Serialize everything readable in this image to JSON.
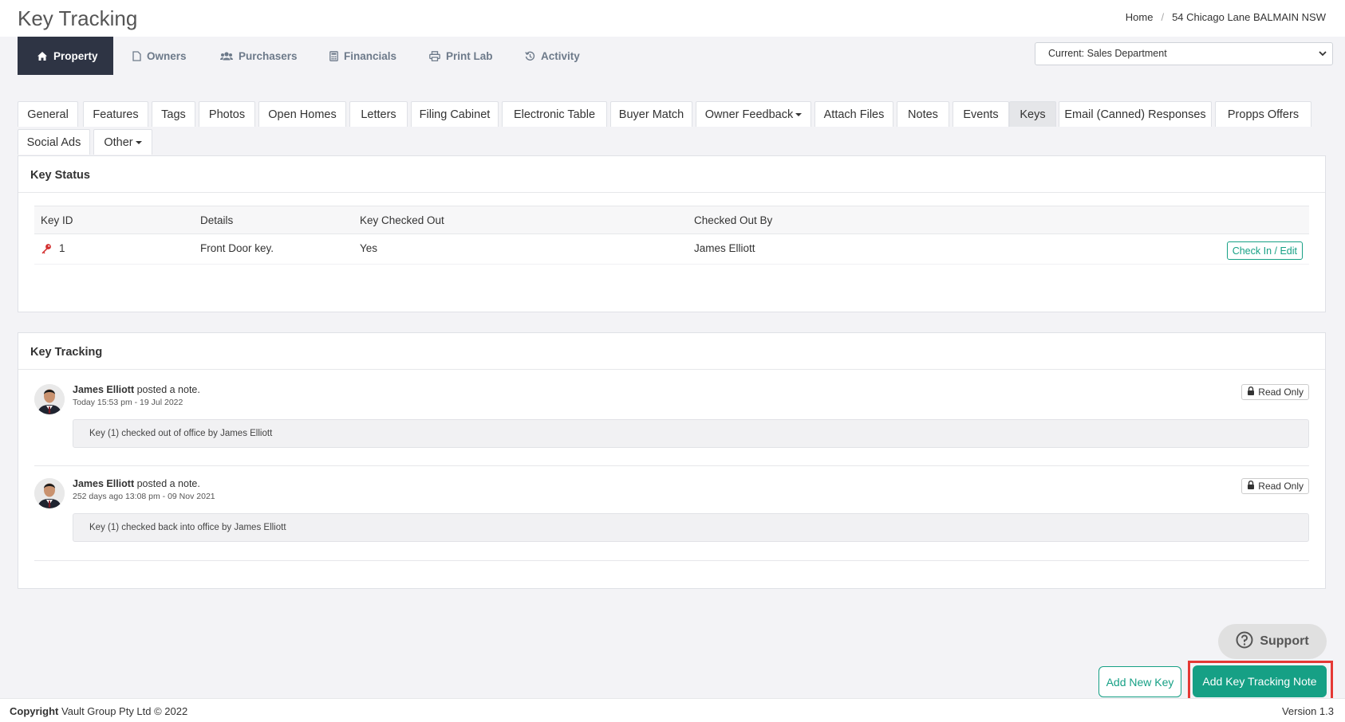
{
  "header": {
    "title": "Key Tracking",
    "breadcrumb": [
      "Home",
      "54 Chicago Lane BALMAIN NSW"
    ]
  },
  "nav": {
    "items": [
      {
        "label": "Property",
        "icon": "home-icon",
        "active": true
      },
      {
        "label": "Owners",
        "icon": "document-icon"
      },
      {
        "label": "Purchasers",
        "icon": "users-icon"
      },
      {
        "label": "Financials",
        "icon": "calculator-icon"
      },
      {
        "label": "Print Lab",
        "icon": "printer-icon"
      },
      {
        "label": "Activity",
        "icon": "history-icon"
      }
    ],
    "department_select": "Current: Sales Department"
  },
  "tabs": [
    "General",
    "Features",
    "Tags",
    "Photos",
    "Open Homes",
    "Letters",
    "Filing Cabinet",
    "Electronic Table",
    "Buyer Match",
    "Owner Feedback",
    "Attach Files",
    "Notes",
    "Events",
    "Keys",
    "Email (Canned) Responses",
    "Propps Offers",
    "Social Ads",
    "Other"
  ],
  "active_tab": "Keys",
  "key_status": {
    "title": "Key Status",
    "columns": [
      "Key ID",
      "Details",
      "Key Checked Out",
      "Checked Out By"
    ],
    "rows": [
      {
        "id": "1",
        "details": "Front Door key.",
        "checked_out": "Yes",
        "by": "James Elliott",
        "action": "Check In / Edit",
        "icon": "key-icon"
      }
    ]
  },
  "key_tracking": {
    "title": "Key Tracking",
    "notes": [
      {
        "author": "James Elliott",
        "verb": "posted a note.",
        "time": "Today 15:53 pm - 19 Jul 2022",
        "badge": "Read Only",
        "body": "Key (1) checked out of office by James Elliott"
      },
      {
        "author": "James Elliott",
        "verb": "posted a note.",
        "time": "252 days ago 13:08 pm - 09 Nov 2021",
        "badge": "Read Only",
        "body": "Key (1) checked back into office by James Elliott"
      }
    ]
  },
  "actions": {
    "support": "Support",
    "add_new_key": "Add New Key",
    "add_key_tracking_note": "Add Key Tracking Note"
  },
  "footer": {
    "copyright_label": "Copyright",
    "copyright_text": "Vault Group Pty Ltd © 2022",
    "version": "Version 1.3"
  },
  "colors": {
    "nav_active": "#2e3444",
    "accent": "#16a085",
    "highlight": "#e53935",
    "key_icon": "#d32f2f"
  }
}
